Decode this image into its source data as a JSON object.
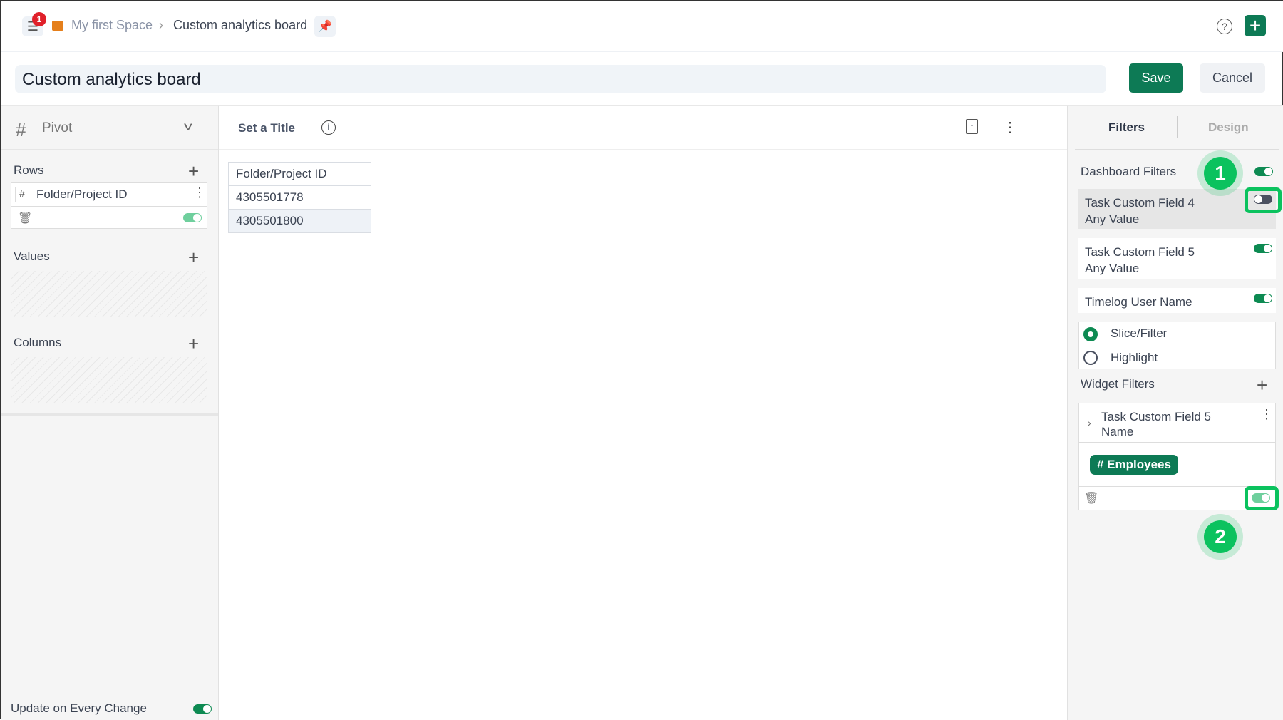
{
  "header": {
    "notification_count": "1",
    "breadcrumb": [
      "My first Space",
      "Custom analytics board"
    ]
  },
  "title_bar": {
    "title": "Custom analytics board",
    "save_label": "Save",
    "cancel_label": "Cancel"
  },
  "left_panel": {
    "widget_type": "Pivot",
    "rows_label": "Rows",
    "row_field": "Folder/Project ID",
    "row_field_icon": "#",
    "values_label": "Values",
    "columns_label": "Columns",
    "update_label": "Update on Every Change"
  },
  "widget": {
    "title_placeholder": "Set a Title",
    "table": {
      "header": "Folder/Project ID",
      "rows": [
        "4305501778",
        "4305501800"
      ]
    }
  },
  "right_panel": {
    "tabs": [
      "Filters",
      "Design"
    ],
    "dashboard_filters_label": "Dashboard Filters",
    "filters": [
      {
        "name": "Task Custom Field 4",
        "value": "Any Value",
        "enabled": false
      },
      {
        "name": "Task Custom Field 5",
        "value": "Any Value",
        "enabled": true
      },
      {
        "name": "Timelog User Name",
        "enabled": true
      }
    ],
    "mode_options": [
      "Slice/Filter",
      "Highlight"
    ],
    "selected_mode": "Slice/Filter",
    "widget_filters_label": "Widget Filters",
    "widget_filter": {
      "name": "Task Custom Field 5",
      "sub": "Name",
      "tag": "# Employees"
    }
  },
  "annotations": [
    "1",
    "2"
  ],
  "colors": {
    "accent": "#0d7a55",
    "badge": "#0bc25e"
  }
}
